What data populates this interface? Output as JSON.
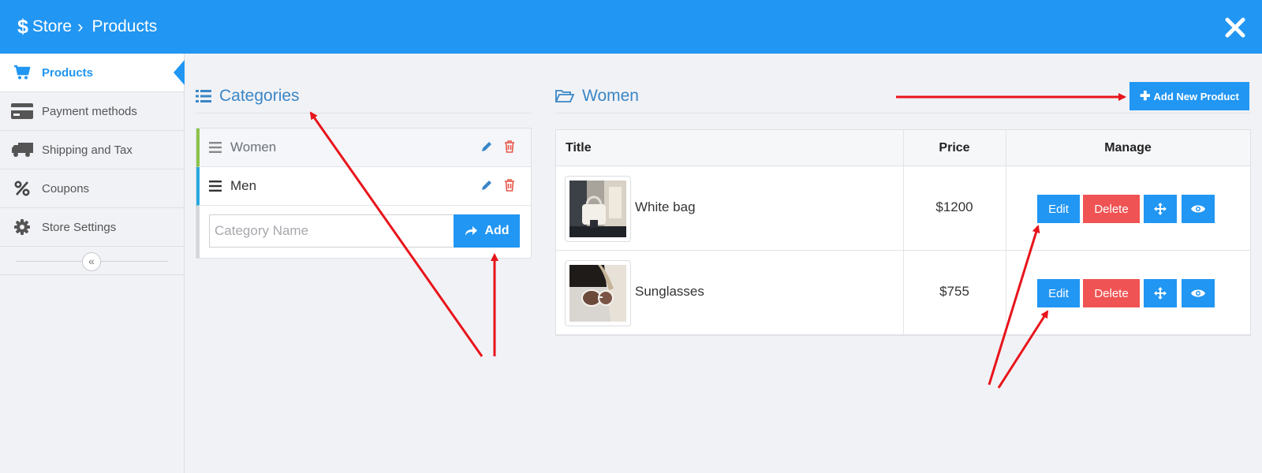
{
  "header": {
    "currency_symbol": "$",
    "store_label": "Store",
    "separator": "›",
    "title": "Products"
  },
  "sidebar": {
    "items": [
      {
        "label": "Products",
        "icon": "cart-icon",
        "active": true
      },
      {
        "label": "Payment methods",
        "icon": "credit-card-icon",
        "active": false
      },
      {
        "label": "Shipping and Tax",
        "icon": "truck-icon",
        "active": false
      },
      {
        "label": "Coupons",
        "icon": "percent-icon",
        "active": false
      },
      {
        "label": "Store Settings",
        "icon": "gear-icon",
        "active": false
      }
    ],
    "collapse_glyph": "«"
  },
  "categories": {
    "title": "Categories",
    "items": [
      {
        "name": "Women",
        "selected": true
      },
      {
        "name": "Men",
        "selected": false
      }
    ],
    "input_placeholder": "Category Name",
    "add_label": "Add"
  },
  "products": {
    "category_title": "Women",
    "add_new_label": "Add New Product",
    "columns": [
      "Title",
      "Price",
      "Manage"
    ],
    "rows": [
      {
        "title": "White bag",
        "price": "$1200",
        "edit": "Edit",
        "delete": "Delete"
      },
      {
        "title": "Sunglasses",
        "price": "$755",
        "edit": "Edit",
        "delete": "Delete"
      }
    ]
  },
  "colors": {
    "primary": "#2196f3",
    "danger": "#f05353",
    "heading": "#3a86c6",
    "annotation_arrow": "#e8141b"
  }
}
